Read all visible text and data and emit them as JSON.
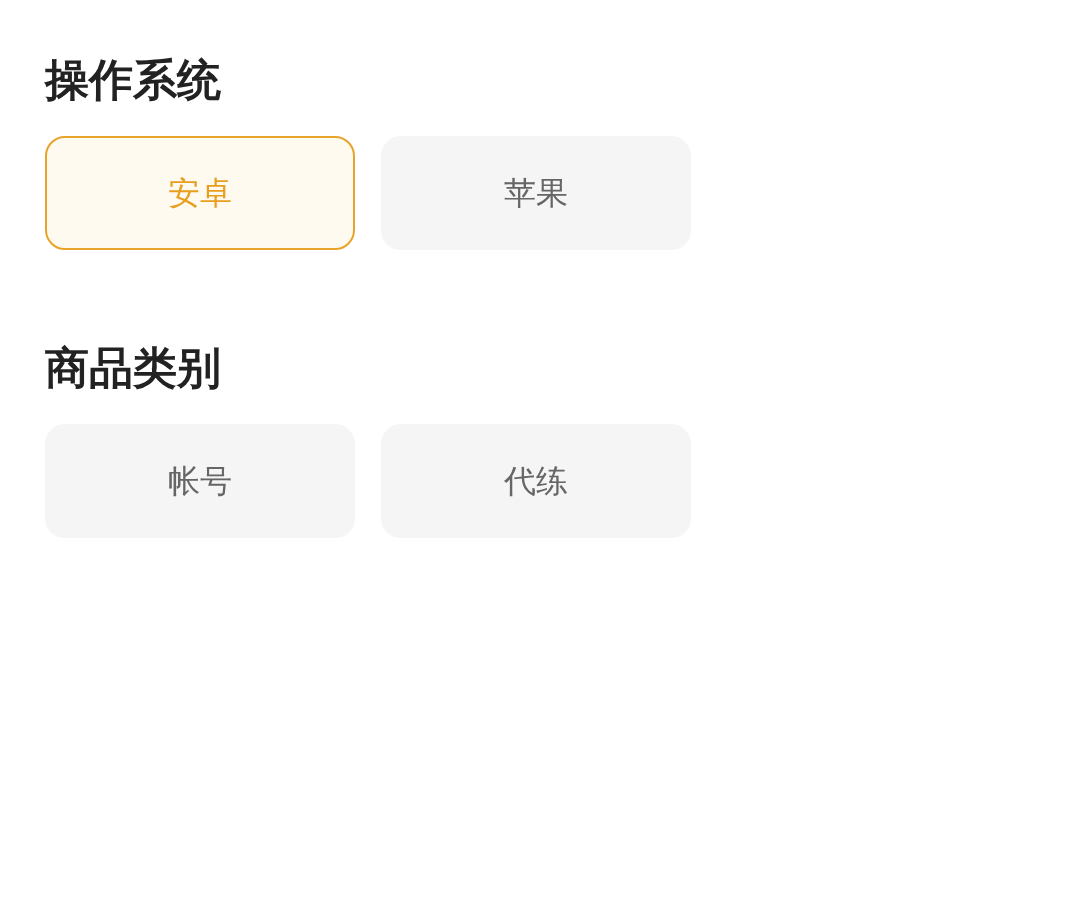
{
  "sections": [
    {
      "title": "操作系统",
      "options": [
        {
          "label": "安卓",
          "selected": true
        },
        {
          "label": "苹果",
          "selected": false
        }
      ]
    },
    {
      "title": "商品类别",
      "options": [
        {
          "label": "帐号",
          "selected": false
        },
        {
          "label": "代练",
          "selected": false
        }
      ]
    }
  ]
}
